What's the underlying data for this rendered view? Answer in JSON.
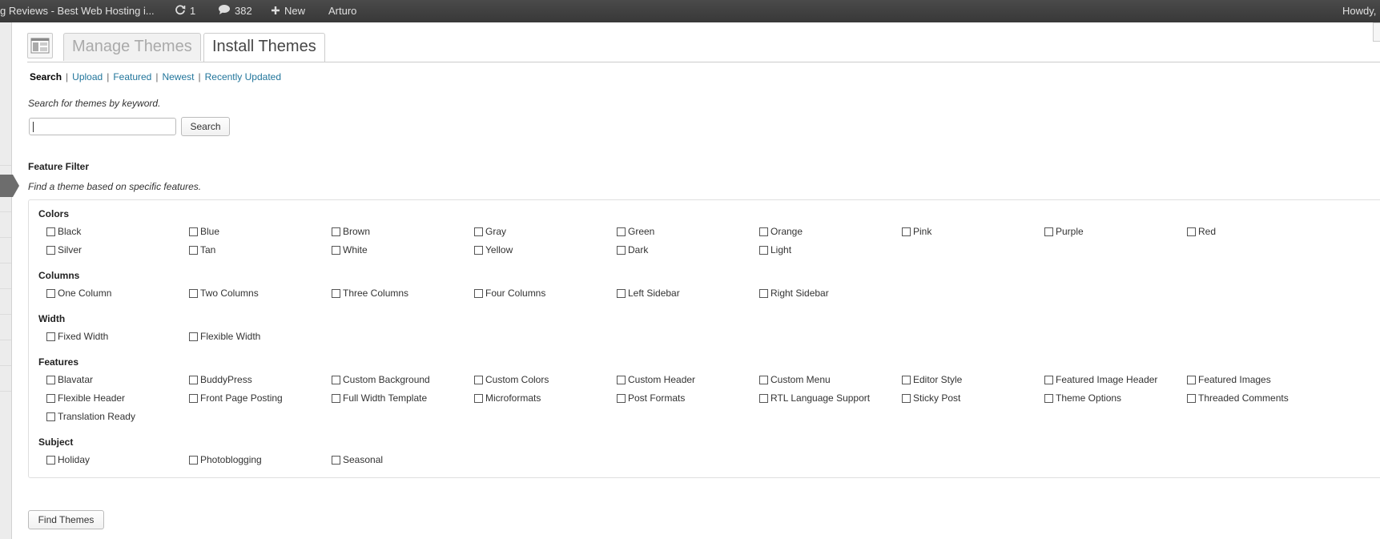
{
  "admin_bar": {
    "site_title": "g Reviews - Best Web Hosting i...",
    "updates_count": "1",
    "comments_count": "382",
    "new_label": "New",
    "user_name": "Arturo",
    "greeting": "Howdy,"
  },
  "tabs": {
    "manage": "Manage Themes",
    "install": "Install Themes"
  },
  "subnav": {
    "search": "Search",
    "upload": "Upload",
    "featured": "Featured",
    "newest": "Newest",
    "recently_updated": "Recently Updated"
  },
  "search": {
    "description": "Search for themes by keyword.",
    "value": "",
    "button_label": "Search"
  },
  "feature_filter": {
    "heading": "Feature Filter",
    "description": "Find a theme based on specific features.",
    "groups": [
      {
        "label": "Colors",
        "options": [
          "Black",
          "Blue",
          "Brown",
          "Gray",
          "Green",
          "Orange",
          "Pink",
          "Purple",
          "Red",
          "Silver",
          "Tan",
          "White",
          "Yellow",
          "Dark",
          "Light"
        ]
      },
      {
        "label": "Columns",
        "options": [
          "One Column",
          "Two Columns",
          "Three Columns",
          "Four Columns",
          "Left Sidebar",
          "Right Sidebar"
        ]
      },
      {
        "label": "Width",
        "options": [
          "Fixed Width",
          "Flexible Width"
        ]
      },
      {
        "label": "Features",
        "options": [
          "Blavatar",
          "BuddyPress",
          "Custom Background",
          "Custom Colors",
          "Custom Header",
          "Custom Menu",
          "Editor Style",
          "Featured Image Header",
          "Featured Images",
          "Flexible Header",
          "Front Page Posting",
          "Full Width Template",
          "Microformats",
          "Post Formats",
          "RTL Language Support",
          "Sticky Post",
          "Theme Options",
          "Threaded Comments",
          "Translation Ready"
        ]
      },
      {
        "label": "Subject",
        "options": [
          "Holiday",
          "Photoblogging",
          "Seasonal"
        ]
      }
    ]
  },
  "find_button": "Find Themes",
  "colors": {
    "admin_bar_bg": "#464646",
    "link": "#21759b"
  }
}
